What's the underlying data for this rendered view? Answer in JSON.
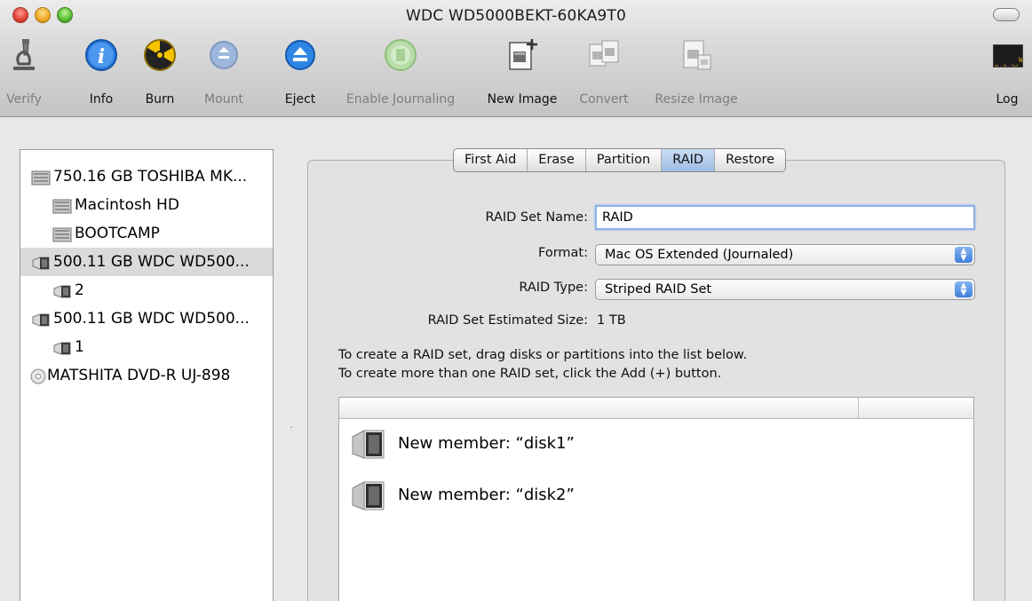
{
  "window": {
    "title": "WDC WD5000BEKT-60KA9T0"
  },
  "toolbar": {
    "items": [
      {
        "label": "Verify",
        "icon": "microscope-icon",
        "enabled": false
      },
      {
        "label": "Info",
        "icon": "info-icon",
        "enabled": true
      },
      {
        "label": "Burn",
        "icon": "burn-icon",
        "enabled": true
      },
      {
        "label": "Mount",
        "icon": "mount-icon",
        "enabled": false
      },
      {
        "label": "Eject",
        "icon": "eject-icon",
        "enabled": true
      },
      {
        "label": "Enable Journaling",
        "icon": "journaling-icon",
        "enabled": false
      },
      {
        "label": "New Image",
        "icon": "new-image-icon",
        "enabled": true
      },
      {
        "label": "Convert",
        "icon": "convert-icon",
        "enabled": false
      },
      {
        "label": "Resize Image",
        "icon": "resize-image-icon",
        "enabled": false
      },
      {
        "label": "Log",
        "icon": "log-icon",
        "enabled": true
      }
    ],
    "log_icon_text": "WARNIN\n9:7:36 I"
  },
  "sidebar": {
    "items": [
      {
        "label": "750.16 GB TOSHIBA MK...",
        "icon": "internal-disk-icon",
        "indent": 0,
        "selected": false
      },
      {
        "label": "Macintosh HD",
        "icon": "volume-icon",
        "indent": 1,
        "selected": false
      },
      {
        "label": "BOOTCAMP",
        "icon": "volume-icon",
        "indent": 1,
        "selected": false
      },
      {
        "label": "500.11 GB WDC WD500...",
        "icon": "external-disk-icon",
        "indent": 0,
        "selected": true
      },
      {
        "label": "2",
        "icon": "external-volume-icon",
        "indent": 1,
        "selected": false
      },
      {
        "label": "500.11 GB WDC WD500...",
        "icon": "external-disk-icon",
        "indent": 0,
        "selected": false
      },
      {
        "label": "1",
        "icon": "external-volume-icon",
        "indent": 1,
        "selected": false
      },
      {
        "label": "MATSHITA DVD-R UJ-898",
        "icon": "optical-drive-icon",
        "indent": 0,
        "selected": false
      }
    ]
  },
  "tabs": [
    {
      "label": "First Aid",
      "active": false
    },
    {
      "label": "Erase",
      "active": false
    },
    {
      "label": "Partition",
      "active": false
    },
    {
      "label": "RAID",
      "active": true
    },
    {
      "label": "Restore",
      "active": false
    }
  ],
  "raid": {
    "name_label": "RAID Set Name:",
    "name_value": "RAID",
    "format_label": "Format:",
    "format_value": "Mac OS Extended (Journaled)",
    "type_label": "RAID Type:",
    "type_value": "Striped RAID Set",
    "size_label": "RAID Set Estimated Size:",
    "size_value": "1 TB",
    "instruction_1": "To create a RAID set, drag disks or partitions into the list below.",
    "instruction_2": "To create more than one RAID set, click the Add (+) button."
  },
  "members": [
    {
      "label": "New member: “disk1”",
      "icon": "external-disk-icon"
    },
    {
      "label": "New member: “disk2”",
      "icon": "external-disk-icon"
    }
  ],
  "colors": {
    "accent": "#3d7fdb",
    "selection": "#dadada",
    "tab_active": "#9fbde6"
  }
}
